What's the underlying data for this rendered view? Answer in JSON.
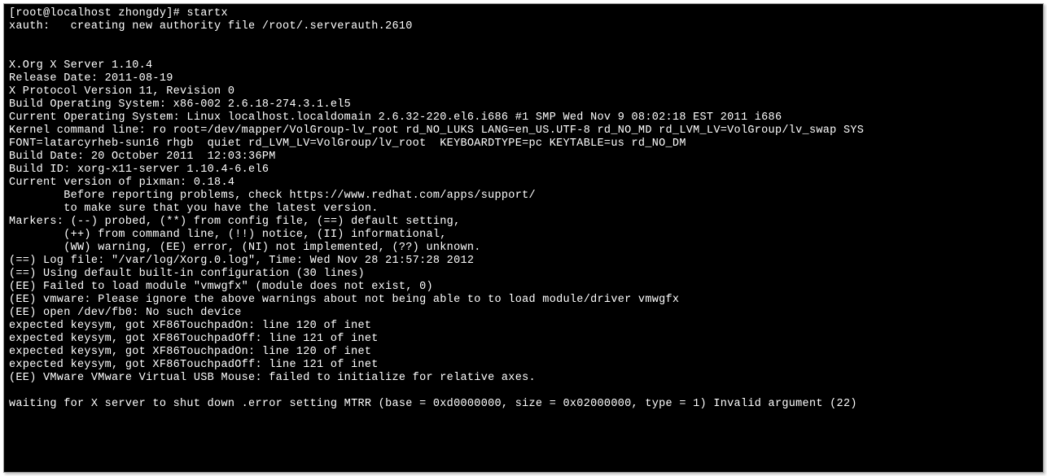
{
  "terminal": {
    "prompt": "[root@localhost zhongdy]# ",
    "command": "startx",
    "lines": [
      "xauth:   creating new authority file /root/.serverauth.2610",
      "",
      "",
      "X.Org X Server 1.10.4",
      "Release Date: 2011-08-19",
      "X Protocol Version 11, Revision 0",
      "Build Operating System: x86-002 2.6.18-274.3.1.el5",
      "Current Operating System: Linux localhost.localdomain 2.6.32-220.el6.i686 #1 SMP Wed Nov 9 08:02:18 EST 2011 i686",
      "Kernel command line: ro root=/dev/mapper/VolGroup-lv_root rd_NO_LUKS LANG=en_US.UTF-8 rd_NO_MD rd_LVM_LV=VolGroup/lv_swap SYS",
      "FONT=latarcyrheb-sun16 rhgb  quiet rd_LVM_LV=VolGroup/lv_root  KEYBOARDTYPE=pc KEYTABLE=us rd_NO_DM",
      "Build Date: 20 October 2011  12:03:36PM",
      "Build ID: xorg-x11-server 1.10.4-6.el6",
      "Current version of pixman: 0.18.4",
      "        Before reporting problems, check https://www.redhat.com/apps/support/",
      "        to make sure that you have the latest version.",
      "Markers: (--) probed, (**) from config file, (==) default setting,",
      "        (++) from command line, (!!) notice, (II) informational,",
      "        (WW) warning, (EE) error, (NI) not implemented, (??) unknown.",
      "(==) Log file: \"/var/log/Xorg.0.log\", Time: Wed Nov 28 21:57:28 2012",
      "(==) Using default built-in configuration (30 lines)",
      "(EE) Failed to load module \"vmwgfx\" (module does not exist, 0)",
      "(EE) vmware: Please ignore the above warnings about not being able to to load module/driver vmwgfx",
      "(EE) open /dev/fb0: No such device",
      "expected keysym, got XF86TouchpadOn: line 120 of inet",
      "expected keysym, got XF86TouchpadOff: line 121 of inet",
      "expected keysym, got XF86TouchpadOn: line 120 of inet",
      "expected keysym, got XF86TouchpadOff: line 121 of inet",
      "(EE) VMware VMware Virtual USB Mouse: failed to initialize for relative axes.",
      "",
      "waiting for X server to shut down .error setting MTRR (base = 0xd0000000, size = 0x02000000, type = 1) Invalid argument (22)"
    ]
  }
}
